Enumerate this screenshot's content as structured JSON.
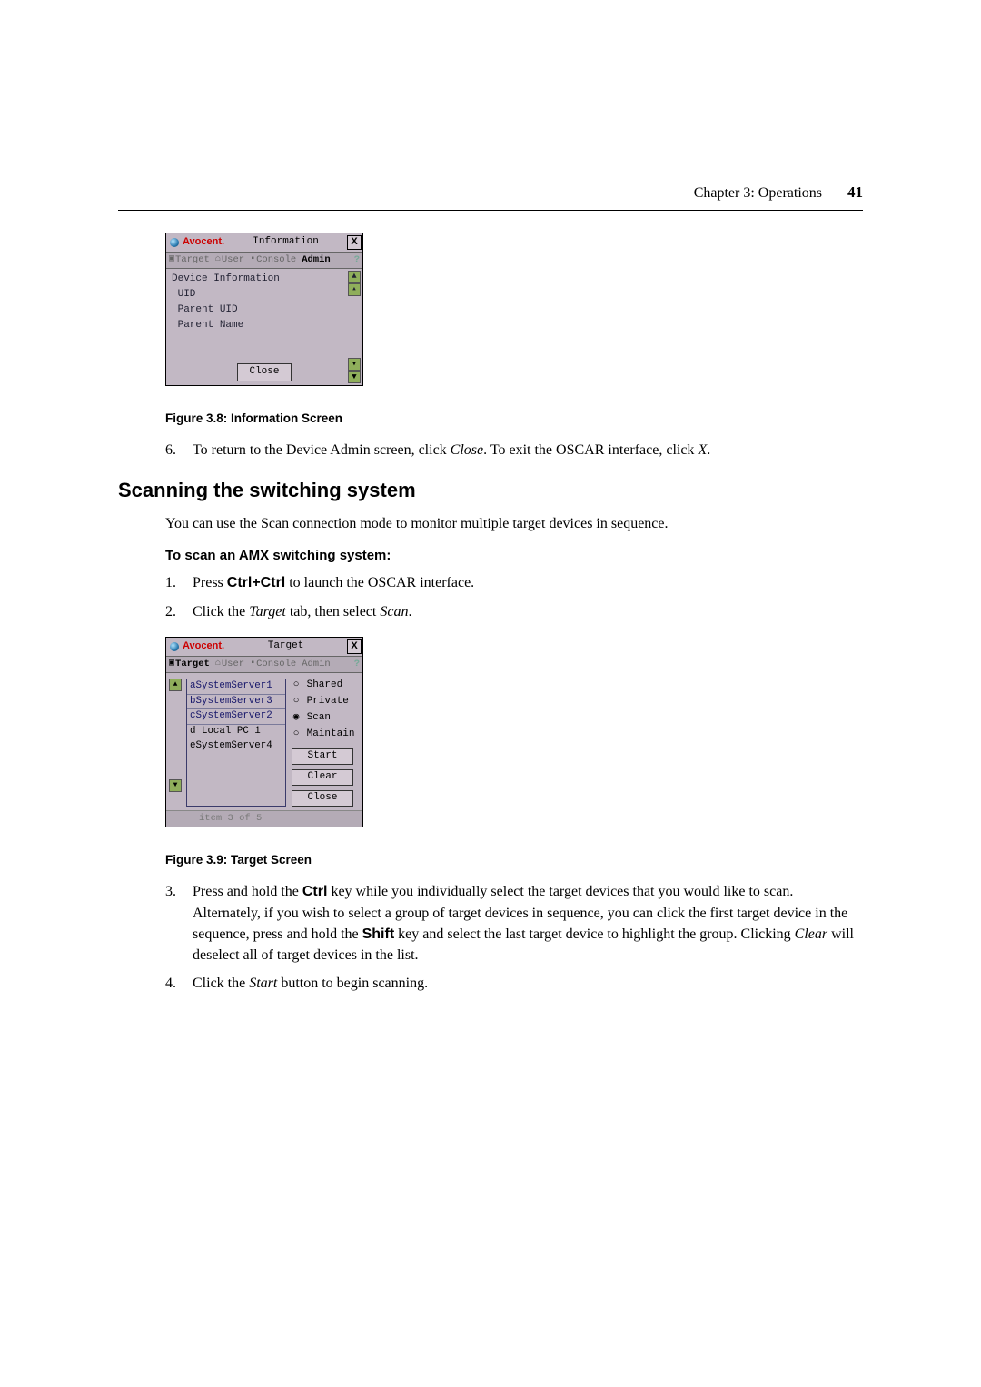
{
  "header": {
    "chapter": "Chapter 3: Operations",
    "page": "41"
  },
  "dialog1": {
    "brand": "Avocent",
    "title": "Information",
    "tabs": {
      "target": "Target",
      "user": "User",
      "console": "Console",
      "admin": "Admin"
    },
    "device_info_heading": "Device Information",
    "rows": {
      "uid": "UID",
      "parent_uid": "Parent UID",
      "parent_name": "Parent Name"
    },
    "close": "Close"
  },
  "caption1": "Figure 3.8: Information Screen",
  "list1": {
    "6": {
      "pre": "To return to the Device Admin screen, click ",
      "close": "Close",
      "mid": ". To exit the OSCAR interface, click ",
      "x": "X",
      "post": "."
    }
  },
  "heading": "Scanning the switching system",
  "intro": "You can use the Scan connection mode to monitor multiple target devices in sequence.",
  "subheading": "To scan an AMX switching system:",
  "list2": {
    "1": {
      "pre": "Press ",
      "key": "Ctrl+Ctrl",
      "post": " to launch the OSCAR interface."
    },
    "2": {
      "pre": "Click the ",
      "tab": "Target",
      "mid": " tab, then select ",
      "scan": "Scan",
      "post": "."
    }
  },
  "dialog2": {
    "brand": "Avocent",
    "title": "Target",
    "tabs": {
      "target": "Target",
      "user": "User",
      "console": "Console",
      "admin": "Admin"
    },
    "items": [
      "aSystemServer1",
      "bSystemServer3",
      "cSystemServer2",
      "d Local PC 1",
      "eSystemServer4"
    ],
    "radios": {
      "shared": "Shared",
      "private": "Private",
      "scan": "Scan",
      "maintain": "Maintain"
    },
    "selected_radio": "scan",
    "buttons": {
      "start": "Start",
      "clear": "Clear",
      "close": "Close"
    },
    "status": "item 3 of 5"
  },
  "caption2": "Figure 3.9: Target Screen",
  "list3": {
    "3": {
      "t1": "Press and hold the ",
      "ctrl": "Ctrl",
      "t2": " key while you individually select the target devices that you would like to scan. Alternately, if you wish to select a group of target devices in sequence, you can click the first target device in the sequence, press and hold the ",
      "shift": "Shift",
      "t3": " key and select the last target device to highlight the group. Clicking ",
      "clear": "Clear",
      "t4": " will deselect all of target devices in the list."
    },
    "4": {
      "t1": "Click the ",
      "start": "Start",
      "t2": " button to begin scanning."
    }
  }
}
